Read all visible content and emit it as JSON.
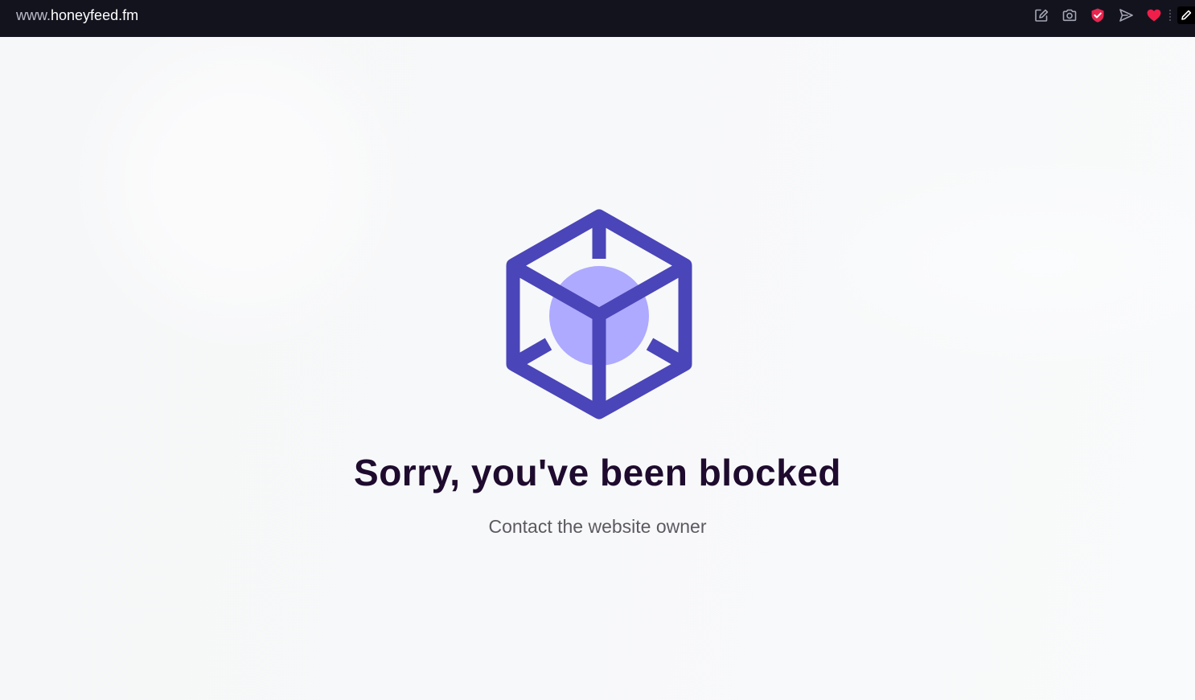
{
  "browser": {
    "url_prefix": "www.",
    "url_domain": "honeyfeed.fm",
    "toolbar_icons": [
      "share-icon",
      "camera-icon",
      "shield-check-icon",
      "send-icon",
      "heart-icon",
      "edit-icon"
    ]
  },
  "page": {
    "title": "Sorry, you've been blocked",
    "subtitle": "Contact the website owner",
    "logo_icon": "cube-icon"
  },
  "colors": {
    "topbar_bg": "#13131e",
    "cube_stroke": "#4a45b8",
    "cube_fill_circle": "#aeaaff",
    "title_text": "#1e0b2e",
    "subtitle_text": "#5c5a61",
    "shield_red": "#e8264f",
    "heart_red": "#f01f4a"
  }
}
